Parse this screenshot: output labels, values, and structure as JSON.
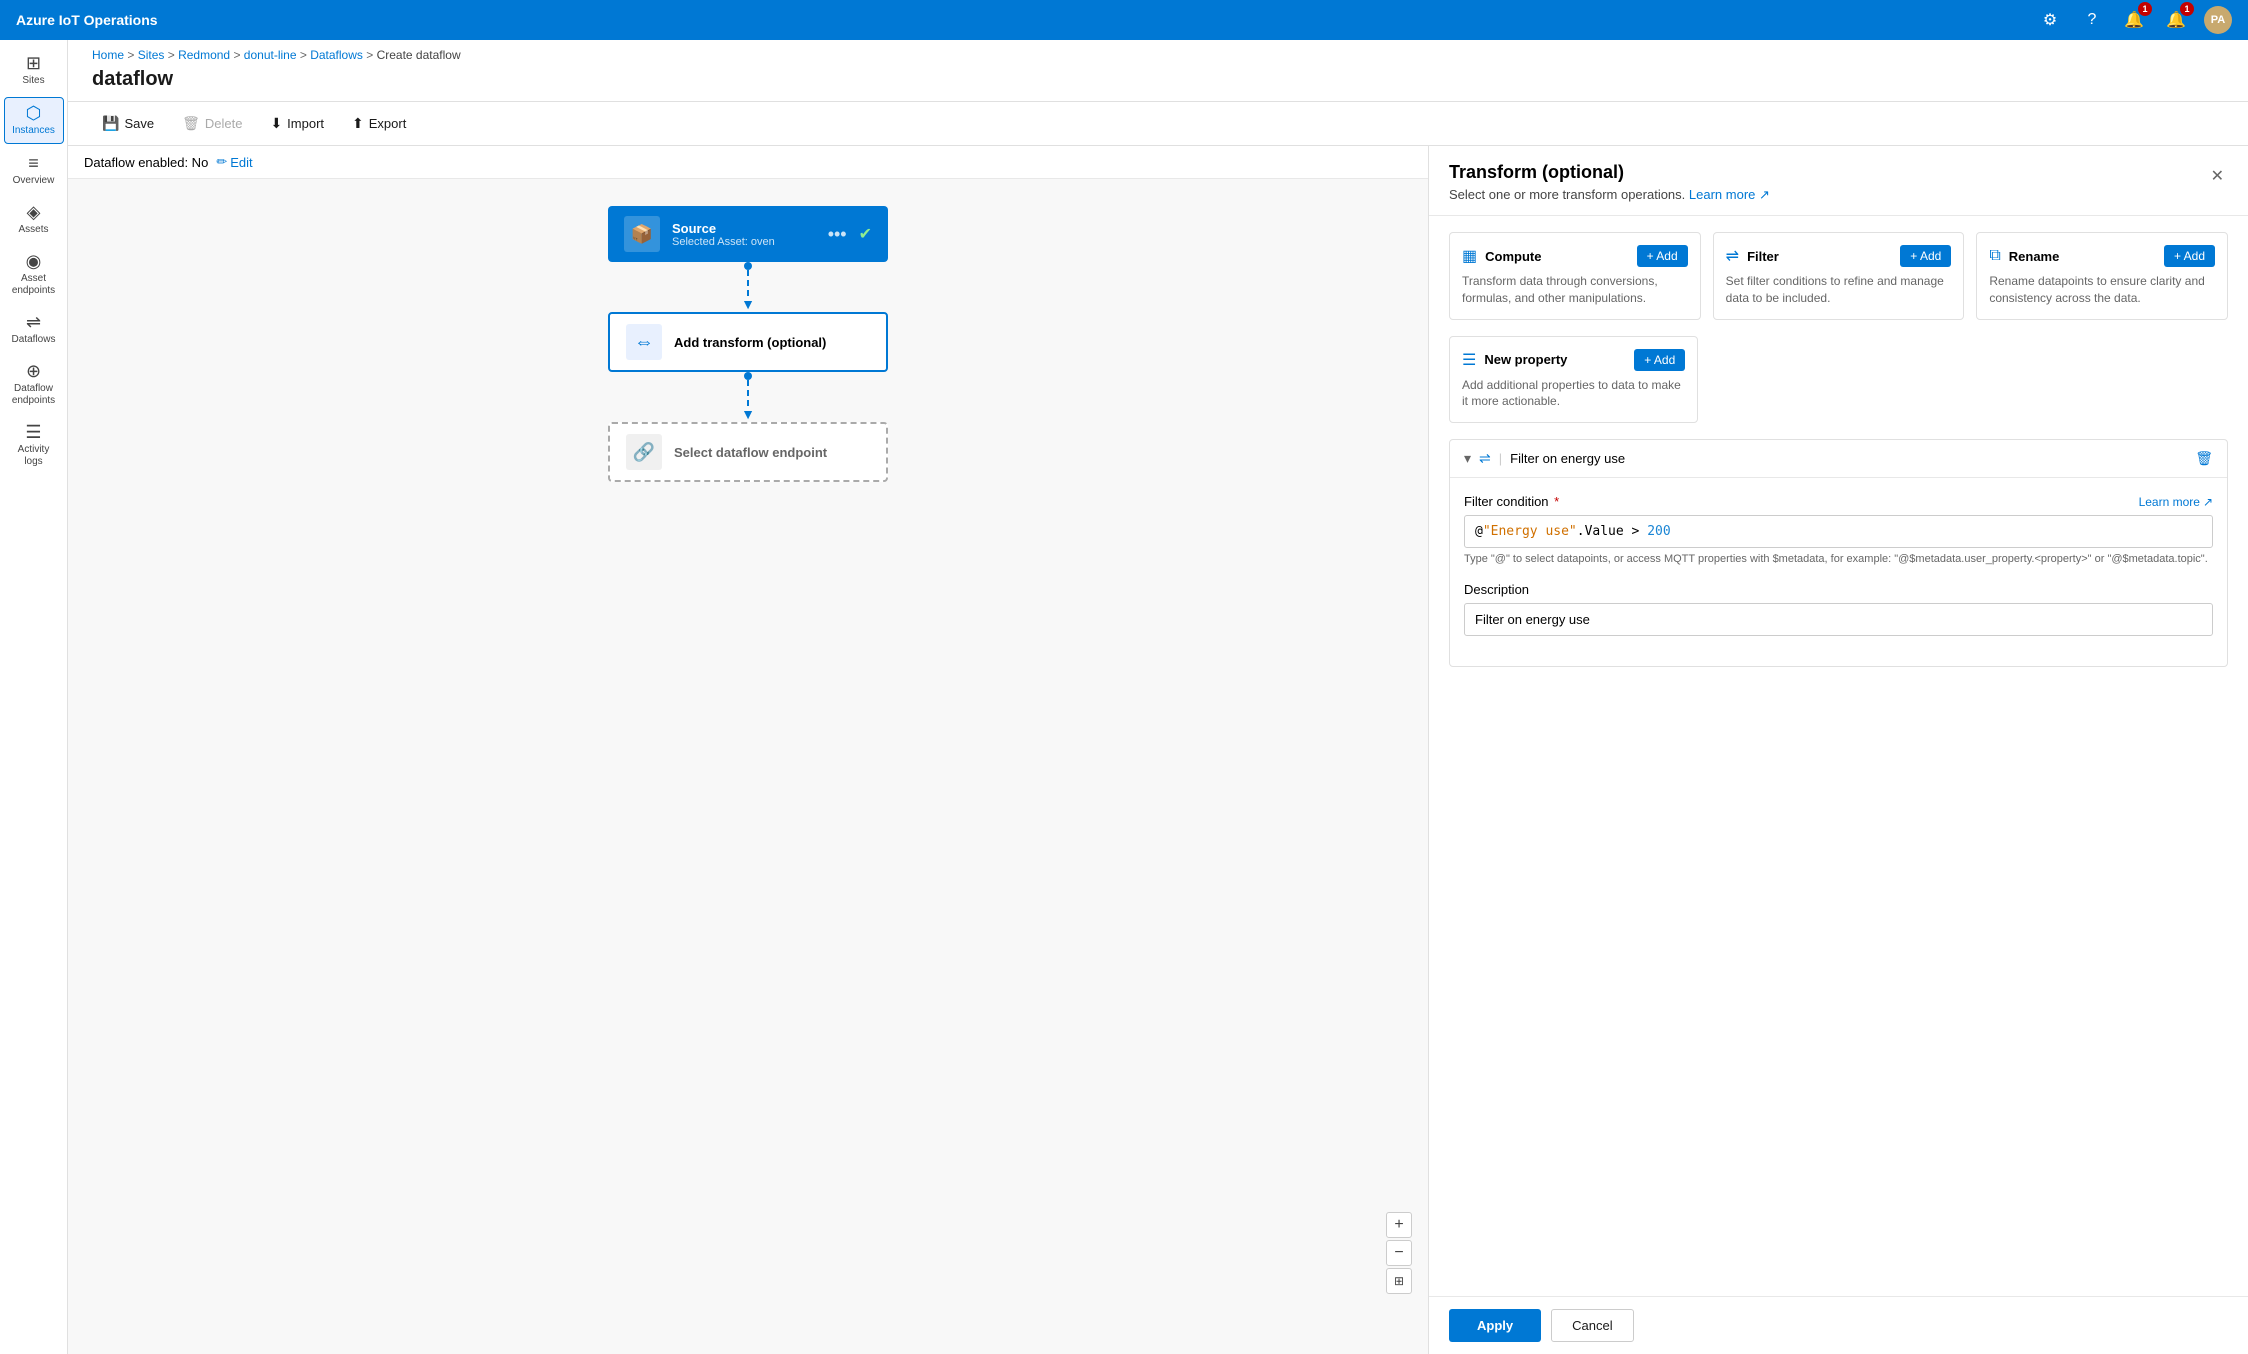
{
  "app": {
    "title": "Azure IoT Operations"
  },
  "topbar": {
    "title": "Azure IoT Operations",
    "settings_icon": "⚙",
    "help_icon": "?",
    "notifications_icon": "🔔",
    "notifications_count": "1",
    "bell_icon": "🔔",
    "bell_count": "1",
    "avatar_initials": "PA"
  },
  "sidebar": {
    "items": [
      {
        "id": "sites",
        "label": "Sites",
        "icon": "⊞"
      },
      {
        "id": "instances",
        "label": "Instances",
        "icon": "⬡"
      },
      {
        "id": "overview",
        "label": "Overview",
        "icon": "≡"
      },
      {
        "id": "assets",
        "label": "Assets",
        "icon": "◈"
      },
      {
        "id": "asset-endpoints",
        "label": "Asset endpoints",
        "icon": "◉"
      },
      {
        "id": "dataflows",
        "label": "Dataflows",
        "icon": "⇌"
      },
      {
        "id": "dataflow-endpoints",
        "label": "Dataflow endpoints",
        "icon": "⊕"
      },
      {
        "id": "activity-logs",
        "label": "Activity logs",
        "icon": "☰"
      }
    ]
  },
  "breadcrumb": {
    "items": [
      "Home",
      "Sites",
      "Redmond",
      "donut-line",
      "Dataflows",
      "Create dataflow"
    ]
  },
  "page": {
    "title": "dataflow"
  },
  "toolbar": {
    "save_label": "Save",
    "delete_label": "Delete",
    "import_label": "Import",
    "export_label": "Export"
  },
  "dataflow_status": {
    "label": "Dataflow enabled: No",
    "edit_label": "Edit"
  },
  "flow": {
    "source": {
      "title": "Source",
      "subtitle": "Selected Asset: oven"
    },
    "transform": {
      "title": "Add transform (optional)"
    },
    "endpoint": {
      "title": "Select dataflow endpoint"
    }
  },
  "panel": {
    "title": "Transform (optional)",
    "subtitle": "Select one or more transform operations.",
    "learn_more": "Learn more",
    "cards": [
      {
        "id": "compute",
        "icon": "▦",
        "title": "Compute",
        "add_label": "+ Add",
        "description": "Transform data through conversions, formulas, and other manipulations."
      },
      {
        "id": "filter",
        "icon": "⇌",
        "title": "Filter",
        "add_label": "+ Add",
        "description": "Set filter conditions to refine and manage data to be included."
      },
      {
        "id": "rename",
        "icon": "⧉",
        "title": "Rename",
        "add_label": "+ Add",
        "description": "Rename datapoints to ensure clarity and consistency across the data."
      },
      {
        "id": "new-property",
        "icon": "☰",
        "title": "New property",
        "add_label": "+ Add",
        "description": "Add additional properties to data to make it more actionable."
      }
    ],
    "filter_section": {
      "name": "Filter on energy use",
      "condition_label": "Filter condition",
      "condition_value": "@\"Energy use\".Value > 200",
      "condition_hint": "Type \"@\" to select datapoints, or access MQTT properties with $metadata, for example: \"@$metadata.user_property.<property>\" or \"@$metadata.topic\".",
      "description_label": "Description",
      "description_value": "Filter on energy use",
      "learn_more": "Learn more"
    },
    "footer": {
      "apply_label": "Apply",
      "cancel_label": "Cancel"
    }
  },
  "zoom": {
    "plus": "+",
    "minus": "−",
    "reset": "⊞"
  }
}
